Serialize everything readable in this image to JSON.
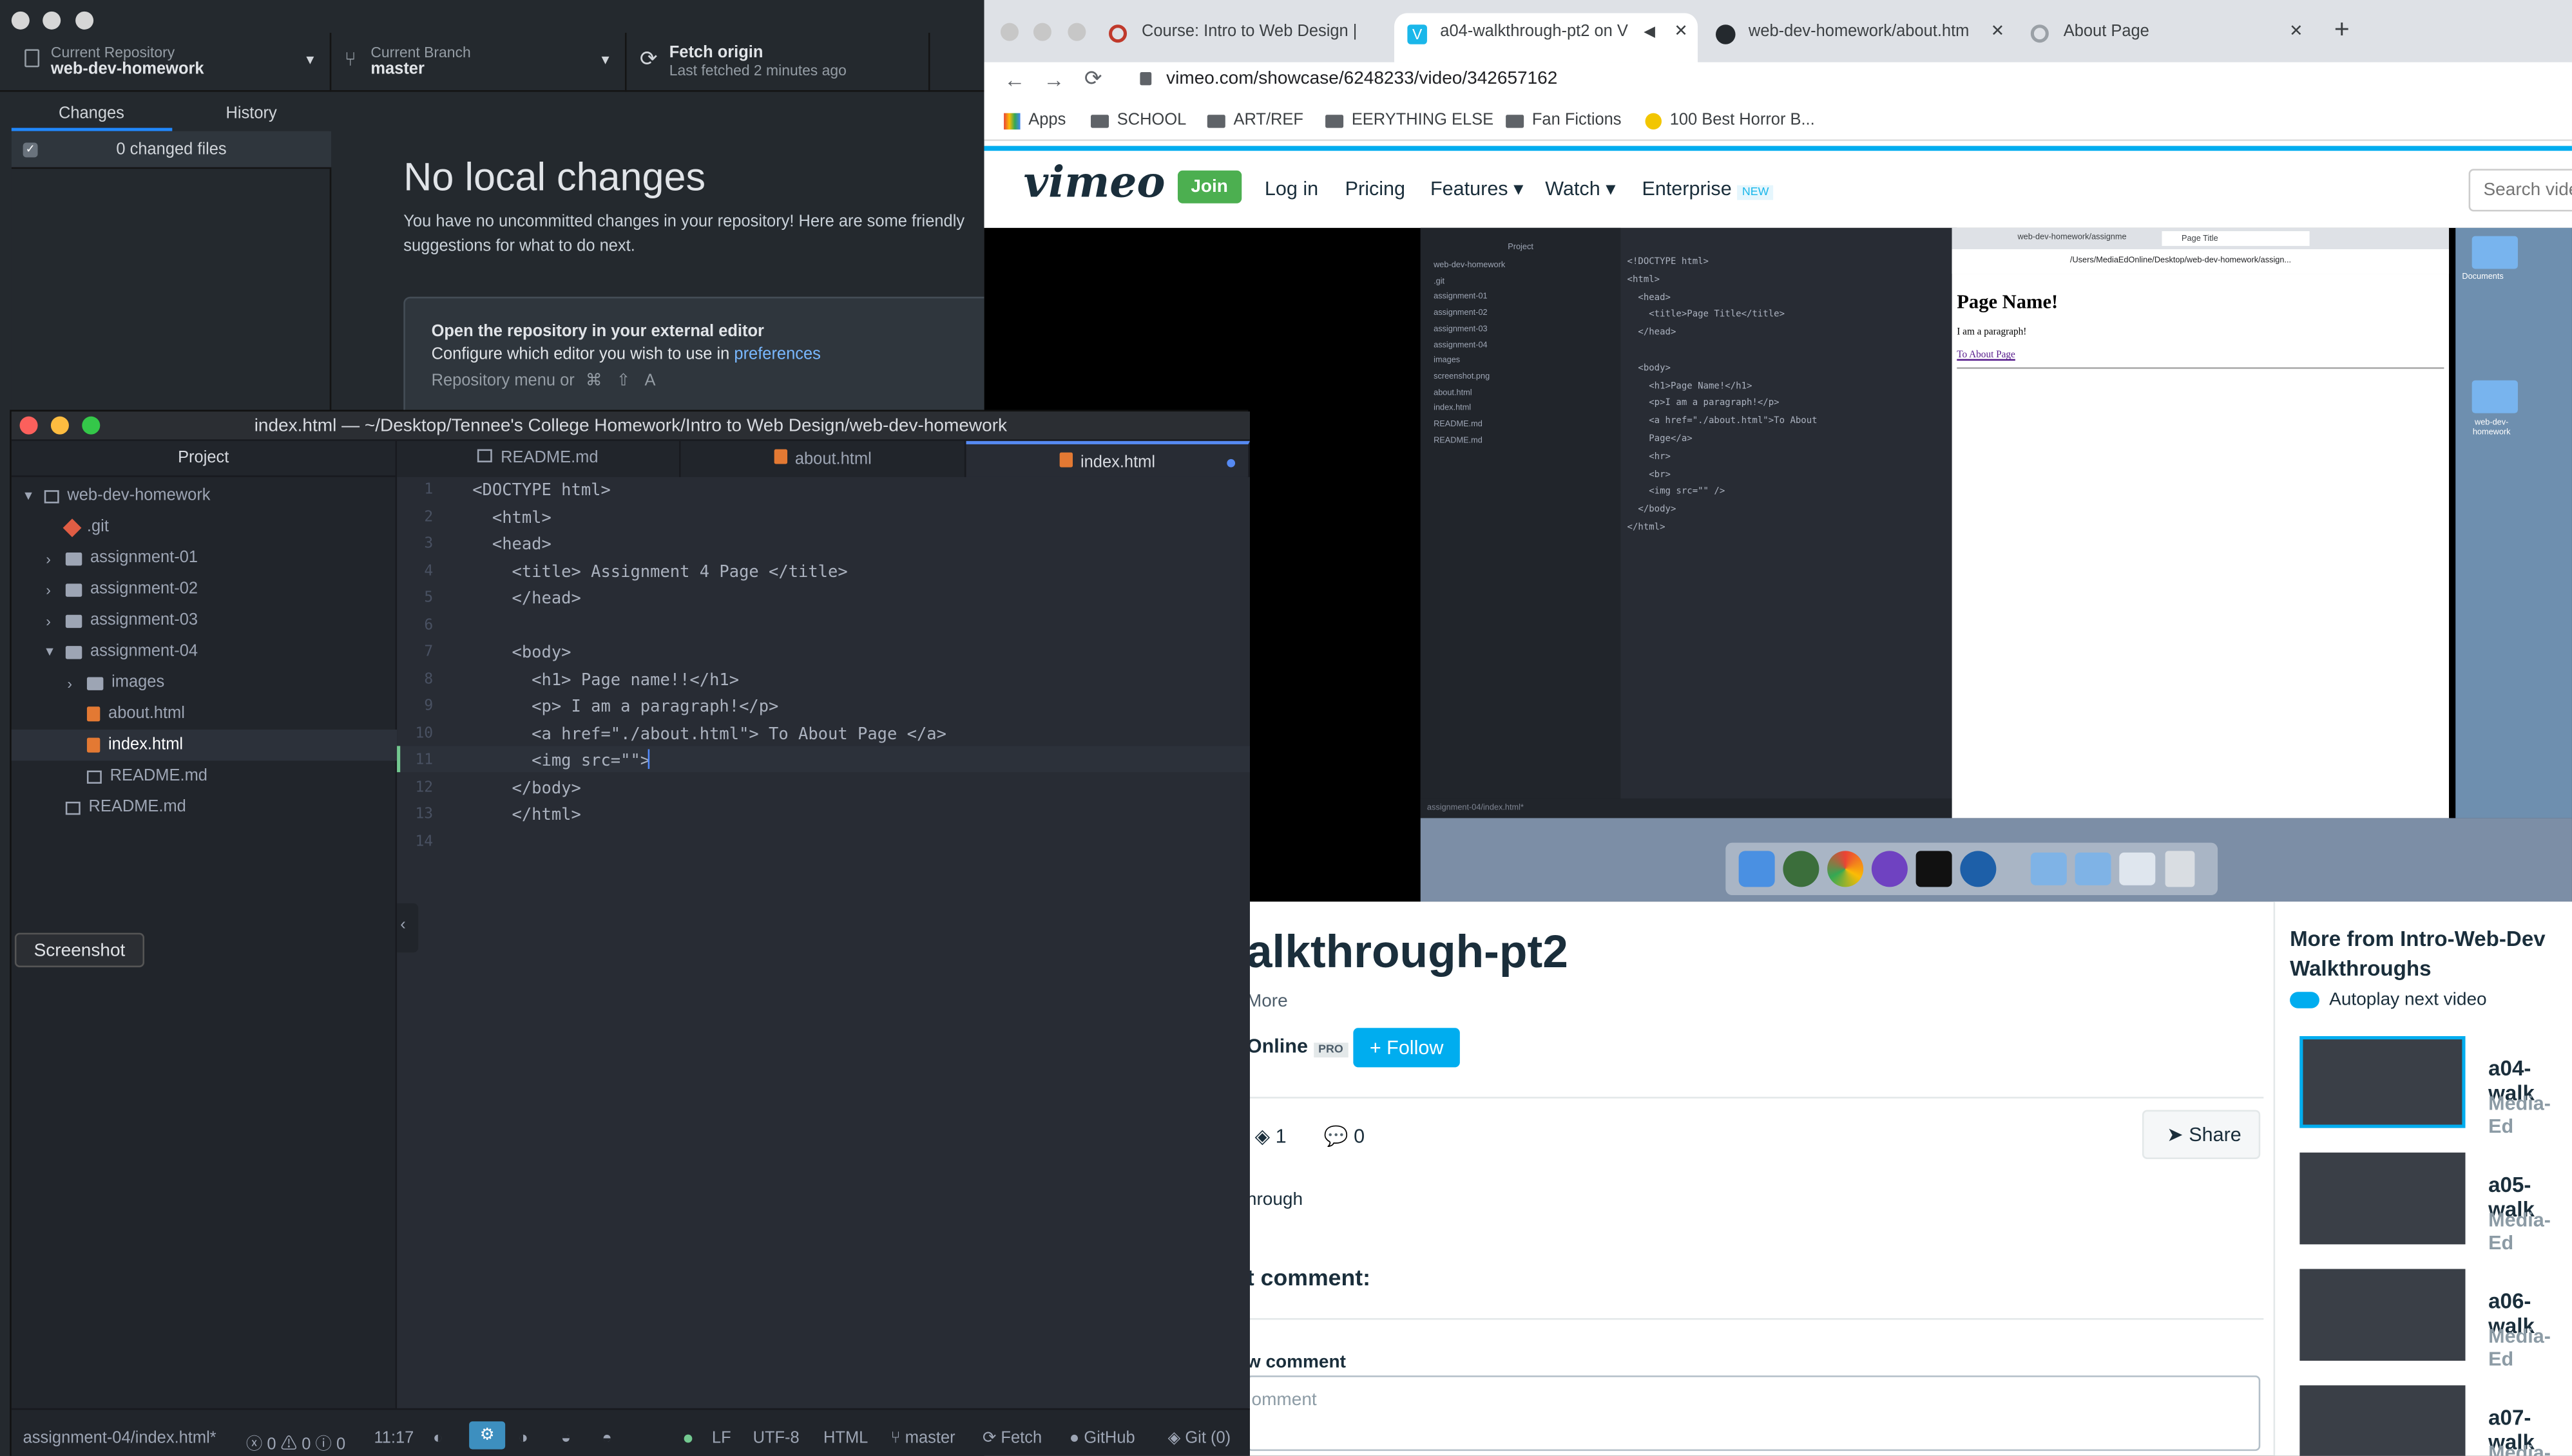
{
  "github": {
    "repo_label": "Current Repository",
    "repo_name": "web-dev-homework",
    "branch_label": "Current Branch",
    "branch_name": "master",
    "fetch_label": "Fetch origin",
    "fetch_sub": "Last fetched 2 minutes ago",
    "tabs": [
      "Changes",
      "History"
    ],
    "changed_files": "0 changed files",
    "no_changes_title": "No local changes",
    "no_changes_desc": "You have no uncommitted changes in your repository! Here are some friendly suggestions for what to do next.",
    "card_title": "Open the repository in your external editor",
    "card_desc": "Configure which editor you wish to use in",
    "card_link": "preferences",
    "card_menu": "Repository menu or",
    "card_keys": [
      "⌘",
      "⇧",
      "A"
    ]
  },
  "screenshot_button": "Screenshot",
  "atom": {
    "window_title": "index.html — ~/Desktop/Tennee's College Homework/Intro to Web Design/web-dev-homework",
    "project_header": "Project",
    "tree": [
      {
        "label": "web-dev-homework",
        "icon": "repo-icon",
        "depth": 0,
        "arrow": "▾"
      },
      {
        "label": ".git",
        "icon": "git-icon",
        "depth": 1,
        "arrow": ""
      },
      {
        "label": "assignment-01",
        "icon": "folder-icon",
        "depth": 1,
        "arrow": "›"
      },
      {
        "label": "assignment-02",
        "icon": "folder-icon",
        "depth": 1,
        "arrow": "›"
      },
      {
        "label": "assignment-03",
        "icon": "folder-icon",
        "depth": 1,
        "arrow": "›"
      },
      {
        "label": "assignment-04",
        "icon": "folder-icon",
        "depth": 1,
        "arrow": "▾"
      },
      {
        "label": "images",
        "icon": "folder-icon",
        "depth": 2,
        "arrow": "›"
      },
      {
        "label": "about.html",
        "icon": "html-file-icon",
        "depth": 2,
        "arrow": ""
      },
      {
        "label": "index.html",
        "icon": "html-file-icon",
        "depth": 2,
        "arrow": "",
        "selected": true
      },
      {
        "label": "README.md",
        "icon": "markdown-file-icon",
        "depth": 2,
        "arrow": ""
      },
      {
        "label": "README.md",
        "icon": "markdown-file-icon",
        "depth": 1,
        "arrow": ""
      }
    ],
    "tabs": [
      "README.md",
      "about.html",
      "index.html"
    ],
    "code": [
      "<DOCTYPE html>",
      "  <html>",
      "  <head>",
      "    <title> Assignment 4 Page </title>",
      "    </head>",
      "",
      "    <body>",
      "      <h1> Page name!!</h1>",
      "      <p> I am a paragraph!</p>",
      "      <a href=\"./about.html\"> To About Page </a>",
      "      <img src=\"\">",
      "    </body>",
      "    </html>",
      ""
    ],
    "status": {
      "file": "assignment-04/index.html*",
      "counts": "0 ⚠ 0 ⓘ 0",
      "position": "11:17",
      "line_ending": "LF",
      "encoding": "UTF-8",
      "grammar": "HTML",
      "branch": "master",
      "fetch": "Fetch",
      "github": "GitHub",
      "git": "Git (0)"
    }
  },
  "browser": {
    "tabs": [
      "Course: Intro to Web Design |",
      "a04-walkthrough-pt2 on V",
      "web-dev-homework/about.htm",
      "About Page"
    ],
    "url": "vimeo.com/showcase/6248233/video/342657162",
    "bookmarks": [
      "Apps",
      "SCHOOL",
      "ART/REF",
      "EERYTHING ELSE",
      "Fan Fictions",
      "100 Best Horror B..."
    ],
    "vimeo": {
      "logo": "vimeo",
      "join": "Join",
      "login": "Log in",
      "pricing": "Pricing",
      "features": "Features",
      "watch": "Watch",
      "enterprise": "Enterprise",
      "new_badge": "NEW",
      "search_placeholder": "Search vide"
    },
    "video_title": "alkthrough-pt2",
    "more_link": "More",
    "channel": "Online",
    "pro_badge": "PRO",
    "follow": "+ Follow",
    "stats": {
      "collections": "1",
      "comments": "0"
    },
    "share": "Share",
    "description": "hrough",
    "comment_heading": "t comment:",
    "new_comment_label": "w comment",
    "comment_placeholder": "omment",
    "sidebar": {
      "heading": "More from Intro-Web-Dev Walkthroughs",
      "autoplay": "Autoplay next video",
      "items": [
        {
          "title": "a04-walk",
          "channel": "Media-Ed"
        },
        {
          "title": "a05-walk",
          "channel": "Media-Ed"
        },
        {
          "title": "a06-walk",
          "channel": "Media-Ed"
        },
        {
          "title": "a07-walk",
          "channel": "Media-Ed"
        }
      ]
    },
    "embedded": {
      "browser_tabs": [
        "web-dev-homework/assignme",
        "Page Title"
      ],
      "file_url": "/Users/MediaEdOnline/Desktop/web-dev-homework/assign...",
      "page_heading": "Page Name!",
      "page_para": "I am a paragraph!",
      "page_link": "To About Page",
      "desktop_icons": [
        "Documents",
        "web-dev-homework"
      ],
      "tree_items": [
        "web-dev-homework",
        ".git",
        "assignment-01",
        "assignment-02",
        "assignment-03",
        "assignment-04",
        "images",
        "screenshot.png",
        "about.html",
        "index.html",
        "README.md",
        "README.md"
      ],
      "code": [
        "<!DOCTYPE html>",
        "<html>",
        "  <head>",
        "    <title>Page Title</title>",
        "  </head>",
        "",
        "  <body>",
        "    <h1>Page Name!</h1>",
        "    <p>I am a paragraph!</p>",
        "    <a href=\"./about.html\">To About",
        "    Page</a>",
        "    <hr>",
        "    <br>",
        "    <img src=\"\" />",
        "  </body>",
        "</html>"
      ]
    }
  }
}
